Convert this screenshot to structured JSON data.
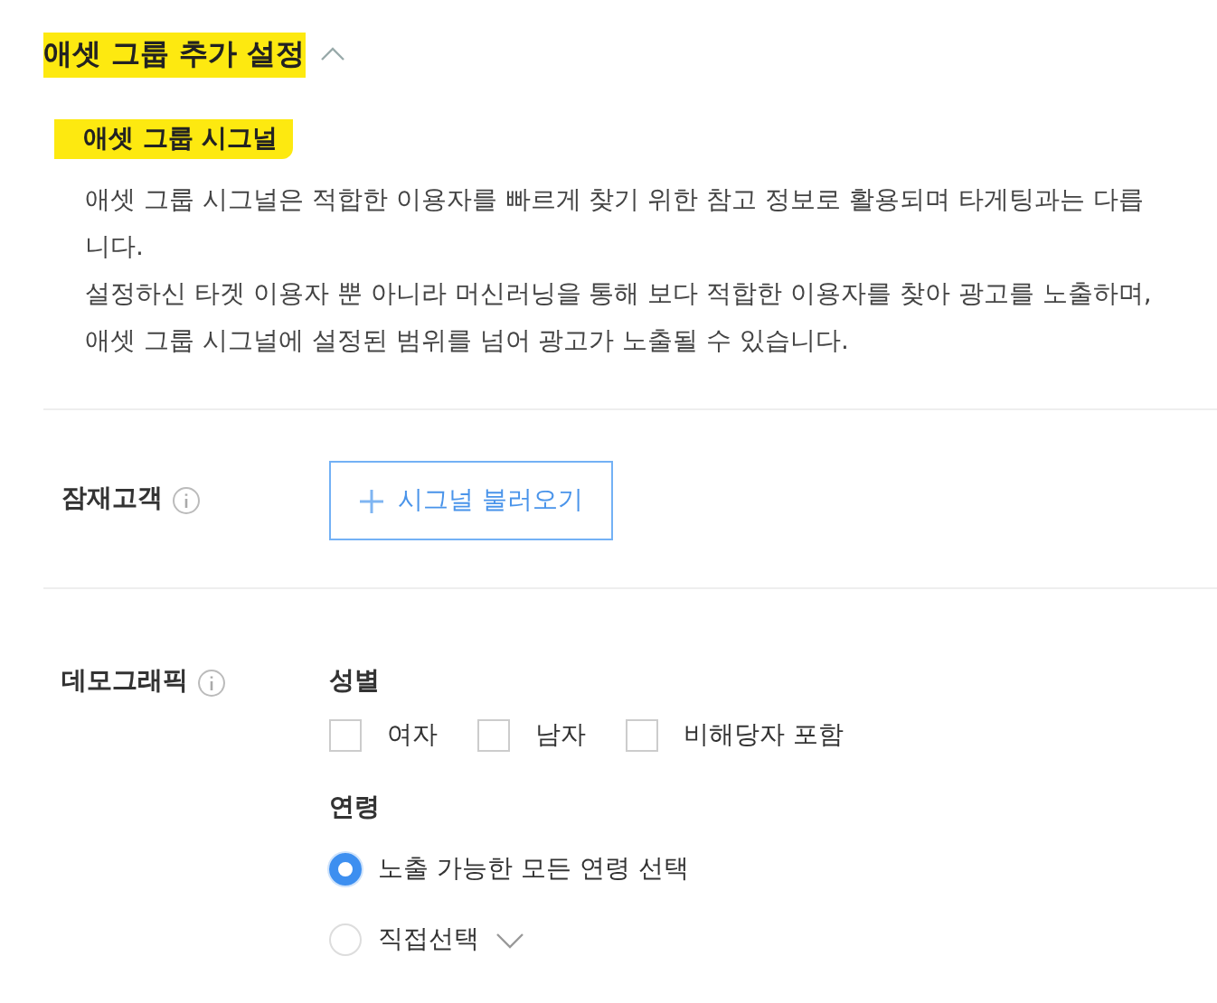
{
  "section": {
    "title": "애셋 그룹 추가 설정",
    "expanded": true,
    "highlighted": true
  },
  "signal": {
    "title": "애셋 그룹 시그널",
    "highlighted": true,
    "description": [
      "애셋 그룹 시그널은 적합한 이용자를 빠르게 찾기 위한 참고 정보로 활용되며 타게팅과는 다릅니다.",
      "설정하신 타겟 이용자 뿐 아니라 머신러닝을 통해 보다 적합한 이용자를 찾아 광고를 노출하며, 애셋 그룹 시그널에 설정된 범위를 넘어 광고가 노출될 수 있습니다."
    ]
  },
  "audience": {
    "label": "잠재고객",
    "button": "시그널 불러오기"
  },
  "demographic": {
    "label": "데모그래픽",
    "gender": {
      "title": "성별",
      "options": [
        {
          "label": "여자",
          "checked": false
        },
        {
          "label": "남자",
          "checked": false
        },
        {
          "label": "비해당자 포함",
          "checked": false
        }
      ]
    },
    "age": {
      "title": "연령",
      "options": [
        {
          "label": "노출 가능한 모든 연령 선택",
          "selected": true,
          "kind": "plain"
        },
        {
          "label": "직접선택",
          "selected": false,
          "kind": "dropdown"
        }
      ]
    }
  }
}
